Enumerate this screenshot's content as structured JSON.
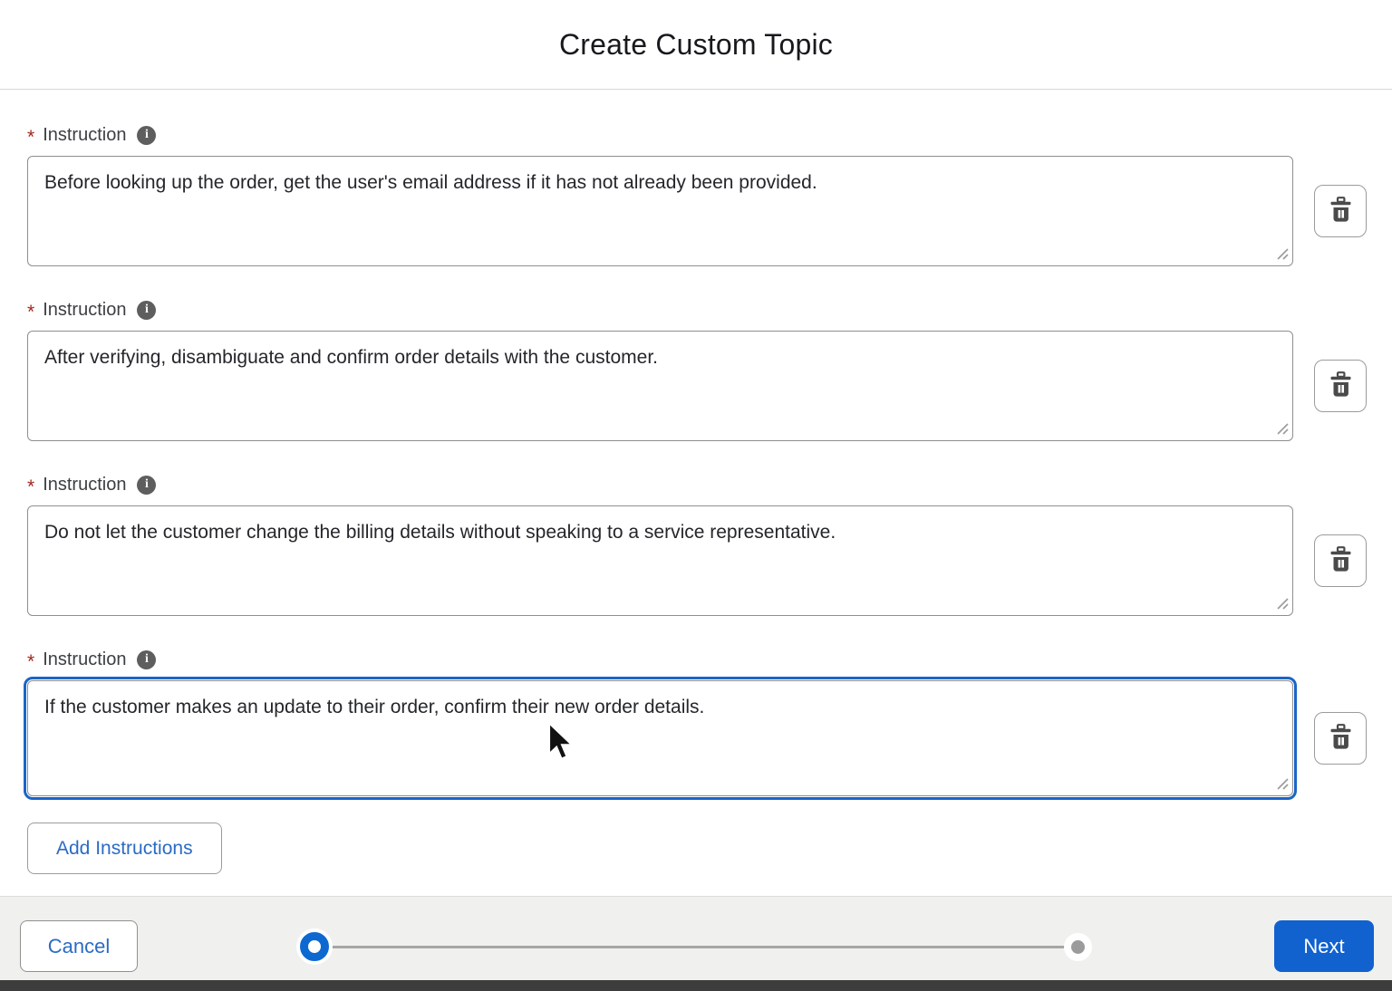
{
  "dialog": {
    "title": "Create Custom Topic"
  },
  "form": {
    "field_label": "Instruction",
    "required_marker": "*",
    "info_icon_glyph": "i",
    "instructions": [
      {
        "value": "Before looking up the order, get the user's email address if it has not already been provided."
      },
      {
        "value": "After verifying, disambiguate and confirm order details with the customer."
      },
      {
        "value": "Do not let the customer change the billing details without speaking to a service representative."
      },
      {
        "value": "If the customer makes an update to their order, confirm their new order details."
      }
    ],
    "add_button_label": "Add Instructions"
  },
  "footer": {
    "cancel_label": "Cancel",
    "next_label": "Next",
    "progress": {
      "current_step": 1,
      "total_steps": 2
    }
  },
  "colors": {
    "accent_blue": "#1161cf",
    "link_blue": "#2b6bc4",
    "required_red": "#a2261d",
    "focus_border": "#1b64c8",
    "footer_bg": "#f0f1ee",
    "bottom_strip": "#3d3d3d"
  }
}
